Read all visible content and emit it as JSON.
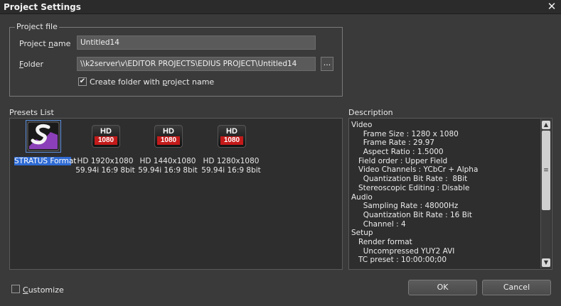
{
  "window": {
    "title": "Project Settings",
    "close_glyph": "✕"
  },
  "project_file": {
    "legend": "Project file",
    "name_label_pre": "Project ",
    "name_label_ul": "n",
    "name_label_post": "ame",
    "name_value": "Untitled14",
    "folder_label_ul": "F",
    "folder_label_post": "older",
    "folder_value": "\\\\k2server\\v\\EDITOR PROJECTS\\EDIUS PROJECT\\Untitled14",
    "browse_label": "...",
    "create_folder_pre": "Create folder with ",
    "create_folder_ul": "p",
    "create_folder_post": "roject name",
    "create_folder_checked": true
  },
  "presets": {
    "label": "Presets List",
    "items": [
      {
        "icon": "stratus-logo-icon",
        "line1": "STRATUS Format",
        "line2": "",
        "selected": true
      },
      {
        "icon": "hd-1080-icon",
        "badge_top": "HD",
        "badge_num": "1080",
        "line1": "HD 1920x1080",
        "line2": "59.94i 16:9 8bit",
        "selected": false
      },
      {
        "icon": "hd-1080-icon",
        "badge_top": "HD",
        "badge_num": "1080",
        "line1": "HD 1440x1080",
        "line2": "59.94i 16:9 8bit",
        "selected": false
      },
      {
        "icon": "hd-1080-icon",
        "badge_top": "HD",
        "badge_num": "1080",
        "line1": "HD 1280x1080",
        "line2": "59.94i 16:9 8bit",
        "selected": false
      }
    ]
  },
  "description": {
    "label": "Description",
    "lines": [
      "Video",
      "     Frame Size : 1280 x 1080",
      "     Frame Rate : 29.97",
      "     Aspect Ratio : 1.5000",
      "   Field order : Upper Field",
      "   Video Channels : YCbCr + Alpha",
      "     Quantization Bit Rate :  8Bit",
      "   Stereoscopic Editing : Disable",
      "Audio",
      "     Sampling Rate : 48000Hz",
      "     Quantization Bit Rate : 16 Bit",
      "     Channel : 4",
      "Setup",
      "   Render format",
      "     Uncompressed YUY2 AVI",
      "   TC preset : 10:00:00;00"
    ]
  },
  "footer": {
    "customize_ul": "C",
    "customize_post": "ustomize",
    "customize_checked": false,
    "ok_label": "OK",
    "cancel_label": "Cancel"
  }
}
